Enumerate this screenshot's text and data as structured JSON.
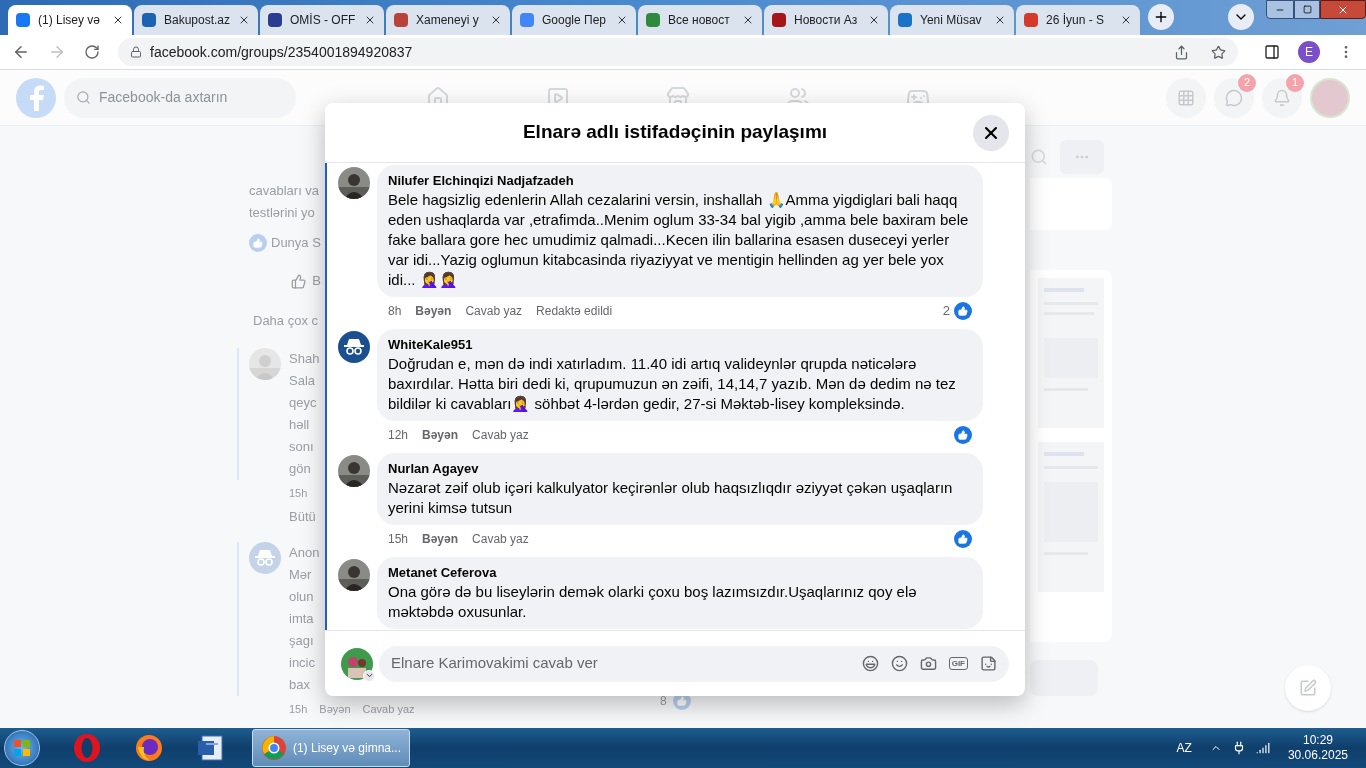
{
  "browser": {
    "tabs": [
      {
        "title": "(1) Lisey və",
        "selected": true,
        "color": "#1877f2"
      },
      {
        "title": "Bakupost.az",
        "selected": false,
        "color": "#1b62b3"
      },
      {
        "title": "OMİS - OFF",
        "selected": false,
        "color": "#2a3c8f"
      },
      {
        "title": "Xameneyi y",
        "selected": false,
        "color": "#b8433a"
      },
      {
        "title": "Google Пер",
        "selected": false,
        "color": "#4285f4"
      },
      {
        "title": "Все новост",
        "selected": false,
        "color": "#2e8b3e"
      },
      {
        "title": "Новости Аз",
        "selected": false,
        "color": "#a4161a"
      },
      {
        "title": "Yeni Müsav",
        "selected": false,
        "color": "#1a73c8"
      },
      {
        "title": "26 İyun - S",
        "selected": false,
        "color": "#d33a2c"
      }
    ],
    "url": "facebook.com/groups/2354001894920837",
    "profile_initial": "E"
  },
  "facebook": {
    "search": {
      "placeholder": "Facebook-da axtarın"
    },
    "messenger_badge": "2",
    "notification_badge": "1"
  },
  "background": {
    "post_lines": [
      "cavabları va",
      "testlərini yo"
    ],
    "reaction_name": "Dunya S",
    "like_label": "B",
    "more_comments": "Daha çox c",
    "replies": [
      {
        "name": "Shah",
        "lines": [
          "Sala",
          "qeyc",
          "həll",
          "sonı",
          "gön"
        ],
        "time": "15h",
        "after": "Bütü"
      },
      {
        "kind": "incognito",
        "name": "Anon",
        "lines": [
          "Mər",
          "olun",
          "imta",
          "şagı",
          "incic",
          "bax"
        ],
        "time": "15h",
        "actions": [
          "Bəyən",
          "Cavab yaz"
        ],
        "like_count": "8"
      }
    ]
  },
  "modal": {
    "title": "Elnarə adlı istifadəçinin paylaşımı",
    "comments": [
      {
        "name": "Nilufer Elchinqizi Nadjafzadeh",
        "text": "Bele hagsizlig edenlerin Allah cezalarini versin, inshallah 🙏Amma yigdiglari bali haqq eden ushaqlarda var ,etrafimda..Menim oglum 33-34 bal yigib ,amma bele baxiram bele fake ballara gore hec umudimiz qalmadi...Kecen ilin ballarina esasen duseceyi yerler var idi...Yazig oglumun kitabcasinda riyaziyyat ve mentigin hellinden ag yer bele yox idi... 🤦‍♀️🤦‍♀️",
        "time": "8h",
        "actions": [
          "Bəyən",
          "Cavab yaz",
          "Redaktə edildi"
        ],
        "like_count": "2"
      },
      {
        "kind": "incognito",
        "name": "WhiteKale951",
        "text": "Doğrudan e, mən də indi xatırladım. 11.40 idi artıq valideynlər qrupda nəticələrə baxırdılar. Hətta biri dedi ki, qrupumuzun ən zəifi, 14,14,7 yazıb. Mən də dedim nə tez bildilər ki cavabları🤦‍♀️ söhbət 4-lərdən gedir, 27-si Məktəb-lisey kompleksində.",
        "time": "12h",
        "actions": [
          "Bəyən",
          "Cavab yaz"
        ]
      },
      {
        "name": "Nurlan Agayev",
        "text": "Nəzarət zəif olub içəri kalkulyator keçirənlər olub haqsızlıqdır əziyyət çəkən uşaqların yerini kimsə tutsun",
        "time": "15h",
        "actions": [
          "Bəyən",
          "Cavab yaz"
        ]
      },
      {
        "name": "Metanet Ceferova",
        "text": "Ona görə də bu liseylərin demək olarki çoxu boş lazımsızdır.Uşaqlarınız qoy elə məktəbdə oxusunlar."
      }
    ],
    "composer": {
      "placeholder": "Elnare Karimovakimi cavab ver",
      "gif_label": "GIF"
    }
  },
  "taskbar": {
    "window": "(1) Lisey və gimna...",
    "language": "AZ",
    "time": "10:29",
    "date": "30.06.2025"
  }
}
